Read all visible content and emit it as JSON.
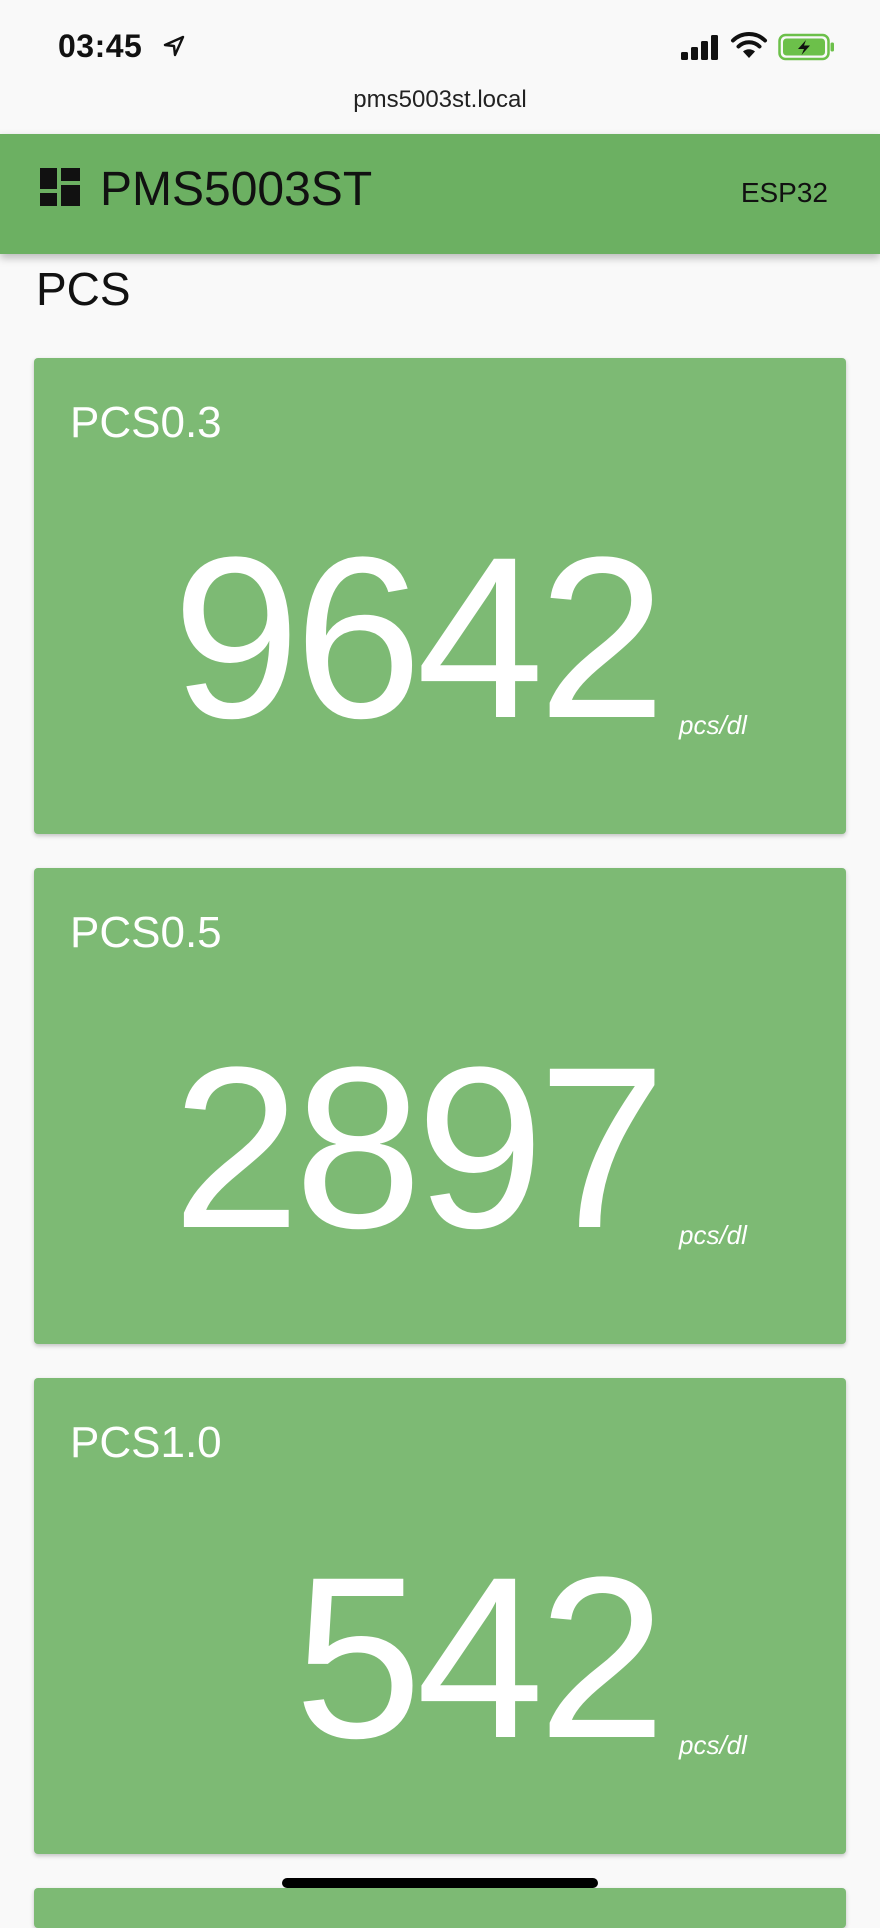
{
  "status_bar": {
    "time": "03:45",
    "icons": [
      "location-arrow-icon",
      "cellular-signal-icon",
      "wifi-icon",
      "battery-charging-icon"
    ]
  },
  "browser": {
    "url": "pms5003st.local"
  },
  "header": {
    "icon": "dashboard-icon",
    "title": "PMS5003ST",
    "device": "ESP32"
  },
  "section": {
    "title": "PCS"
  },
  "cards": [
    {
      "label": "PCS0.3",
      "value": "9642",
      "unit": "pcs/dl"
    },
    {
      "label": "PCS0.5",
      "value": "2897",
      "unit": "pcs/dl"
    },
    {
      "label": "PCS1.0",
      "value": "542",
      "unit": "pcs/dl"
    }
  ],
  "colors": {
    "header_bg": "#6cb062",
    "card_bg": "#7dba74",
    "card_text": "#ffffff",
    "page_bg": "#f9f9f9",
    "battery_fill": "#6cc04a"
  }
}
